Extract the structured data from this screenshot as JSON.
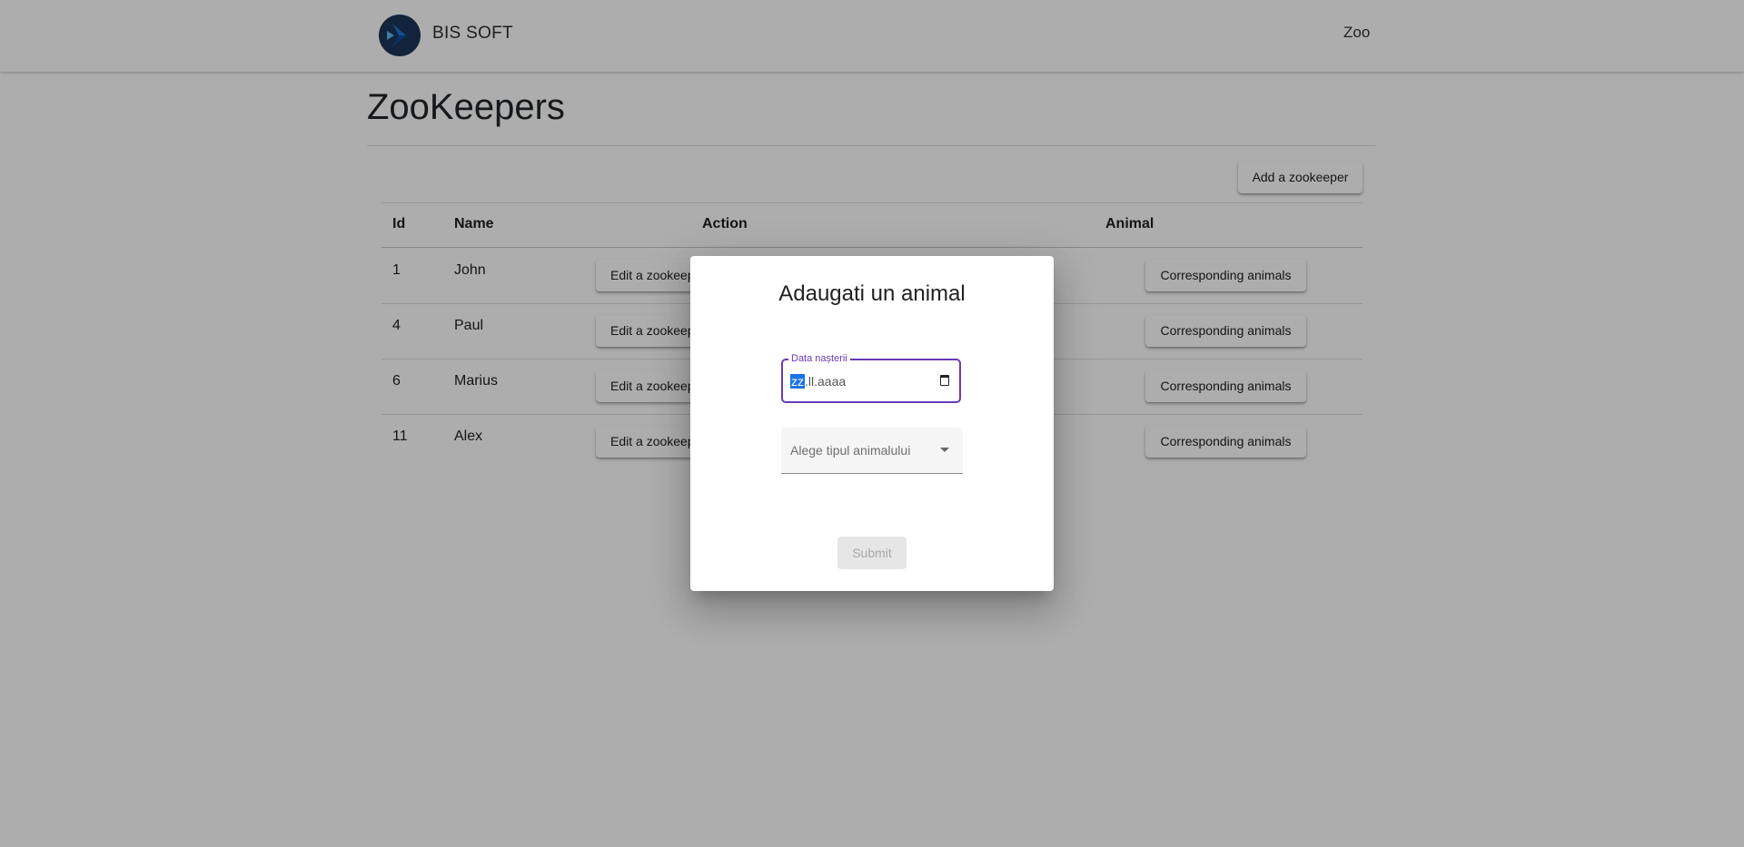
{
  "navbar": {
    "brand": "BIS SOFT",
    "links": {
      "zoo": "Zoo"
    },
    "logo_icon": "diamond-logo-icon",
    "logo_colors": {
      "circle": "#1b3558",
      "mark": "#1976d2"
    }
  },
  "page": {
    "title": "ZooKeepers",
    "add_button": "Add a zookeeper"
  },
  "table": {
    "headers": {
      "id": "Id",
      "name": "Name",
      "action": "Action",
      "animal": "Animal"
    },
    "rows": [
      {
        "id": "1",
        "name": "John",
        "edit": "Edit a zookeeper",
        "animals": "Corresponding animals"
      },
      {
        "id": "4",
        "name": "Paul",
        "edit": "Edit a zookeeper",
        "animals": "Corresponding animals"
      },
      {
        "id": "6",
        "name": "Marius",
        "edit": "Edit a zookeeper",
        "animals": "Corresponding animals"
      },
      {
        "id": "11",
        "name": "Alex",
        "edit": "Edit a zookeeper",
        "animals": "Corresponding animals"
      }
    ]
  },
  "dialog": {
    "title": "Adaugati un animal",
    "date_field": {
      "label": "Data nașterii",
      "value_selected": "zz",
      "value_rest": ".ll.aaaa",
      "icon": "calendar-icon"
    },
    "select_field": {
      "placeholder": "Alege tipul animalului",
      "icon": "arrow-drop-down-icon"
    },
    "submit": "Submit"
  },
  "colors": {
    "accent": "#673ab7",
    "selection": "#1a73e8",
    "backdrop": "rgba(0,0,0,0.32)"
  }
}
